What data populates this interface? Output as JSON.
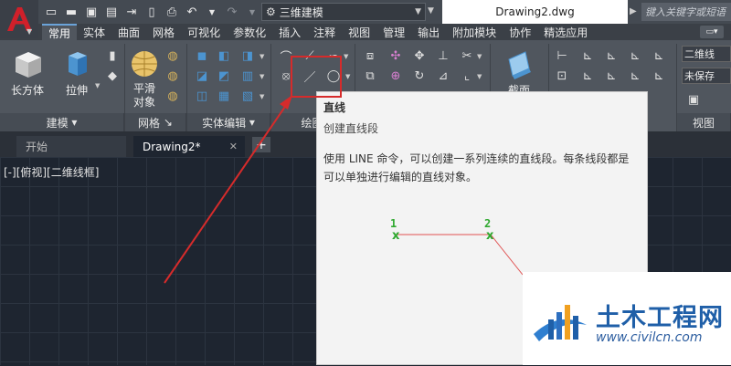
{
  "app": {
    "logo_letter": "A",
    "workspace": "三维建模",
    "doc_title": "Drawing2.dwg",
    "search_placeholder": "键入关键字或短语"
  },
  "ribbon_tabs": [
    "常用",
    "实体",
    "曲面",
    "网格",
    "可视化",
    "参数化",
    "插入",
    "注释",
    "视图",
    "管理",
    "输出",
    "附加模块",
    "协作",
    "精选应用"
  ],
  "ribbon": {
    "box_label": "长方体",
    "extrude_label": "拉伸",
    "smooth_label_1": "平滑",
    "smooth_label_2": "对象",
    "section_label": "截面",
    "panels": {
      "modeling": "建模",
      "mesh": "网格",
      "solid_edit": "实体编辑",
      "draw": "绘图",
      "view": "视图"
    },
    "right_combo_1": "二维线",
    "right_combo_2": "未保存"
  },
  "doc_tabs": {
    "start": "开始",
    "active": "Drawing2*"
  },
  "viewport_label": "[-][俯视][二维线框]",
  "tooltip": {
    "title": "直线",
    "subtitle": "创建直线段",
    "description": "使用 LINE 命令，可以创建一系列连续的直线段。每条线段都是可以单独进行编辑的直线对象。",
    "point_1": "1",
    "point_2": "2"
  },
  "watermark": {
    "title": "土木工程网",
    "url": "www.civilcn.com"
  },
  "colors": {
    "accent": "#6aa3d9",
    "highlight": "#d62b2b",
    "point": "#2fa82f"
  }
}
